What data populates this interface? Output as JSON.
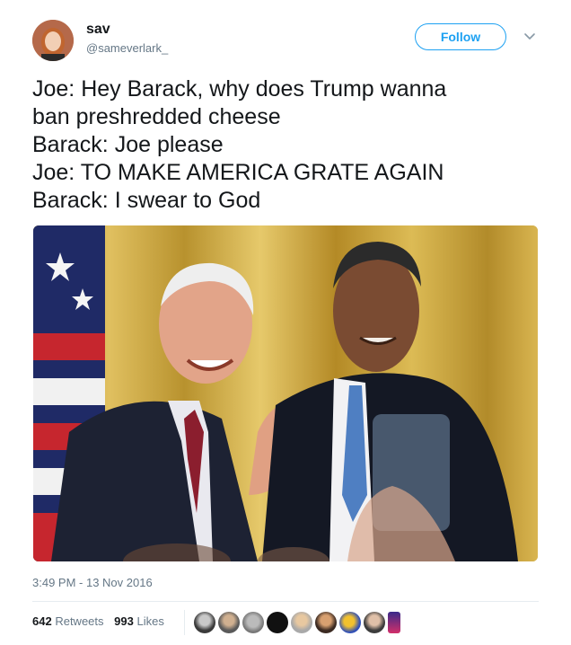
{
  "user": {
    "name": "sav",
    "handle": "@sameverlark_"
  },
  "follow_label": "Follow",
  "tweet_lines": [
    "Joe: Hey Barack, why does Trump wanna",
    "ban preshredded cheese",
    "Barack: Joe please",
    "Joe: TO MAKE AMERICA GRATE AGAIN",
    "Barack: I swear to God"
  ],
  "timestamp": "3:49 PM - 13 Nov 2016",
  "stats": {
    "retweets_count": "642",
    "retweets_label": "Retweets",
    "likes_count": "993",
    "likes_label": "Likes"
  },
  "colors": {
    "accent": "#1da1f2",
    "secondary_text": "#657786"
  },
  "icons": {
    "menu": "chevron-down-icon"
  }
}
